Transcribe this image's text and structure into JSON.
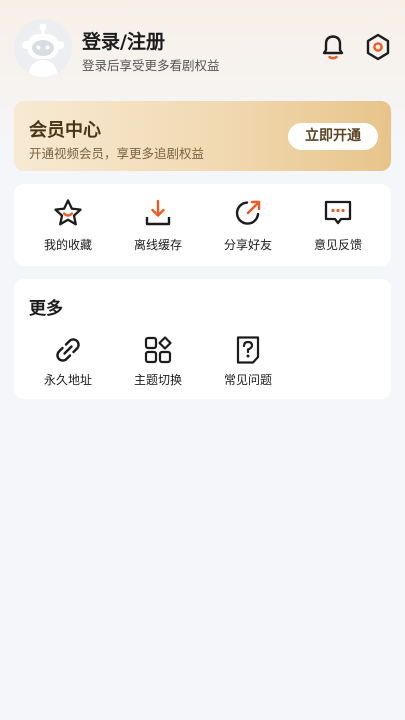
{
  "header": {
    "login_title": "登录/注册",
    "login_subtitle": "登录后享受更多看剧权益",
    "icons": [
      "bell-icon",
      "settings-icon"
    ]
  },
  "vip": {
    "title": "会员中心",
    "subtitle": "开通视频会员，享更多追剧权益",
    "button_label": "立即开通"
  },
  "quick_actions": [
    {
      "label": "我的收藏",
      "icon": "star-icon"
    },
    {
      "label": "离线缓存",
      "icon": "download-icon"
    },
    {
      "label": "分享好友",
      "icon": "share-icon"
    },
    {
      "label": "意见反馈",
      "icon": "feedback-icon"
    }
  ],
  "more": {
    "title": "更多",
    "items": [
      {
        "label": "永久地址",
        "icon": "link-icon"
      },
      {
        "label": "主题切换",
        "icon": "theme-icon"
      },
      {
        "label": "常见问题",
        "icon": "faq-icon"
      }
    ]
  },
  "colors": {
    "accent": "#f05a24",
    "vip_gold": "#e8c48a",
    "text": "#1c1c1e"
  }
}
